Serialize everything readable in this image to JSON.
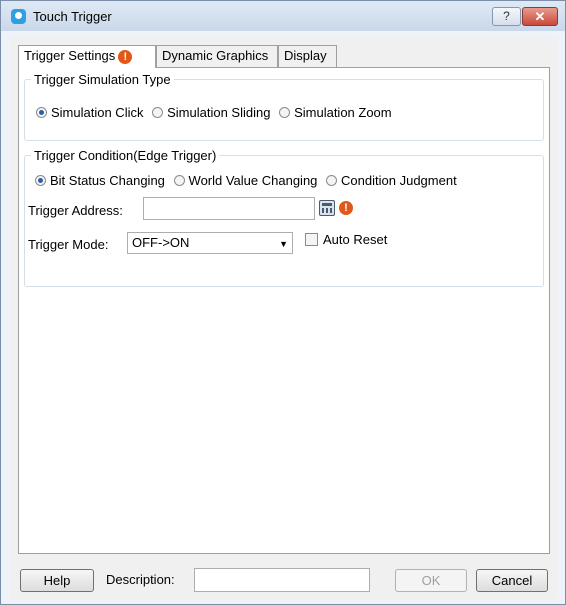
{
  "window": {
    "title": "Touch Trigger",
    "help_glyph": "?",
    "close_glyph": "✕"
  },
  "tabs": [
    {
      "label": "Trigger Settings",
      "warning": "!"
    },
    {
      "label": "Dynamic Graphics"
    },
    {
      "label": "Display"
    }
  ],
  "simulation_type": {
    "title": "Trigger Simulation Type",
    "options": [
      "Simulation Click",
      "Simulation Sliding",
      "Simulation Zoom"
    ],
    "selected": "Simulation Click"
  },
  "condition": {
    "title": "Trigger Condition(Edge Trigger)",
    "options": [
      "Bit Status Changing",
      "World Value Changing",
      "Condition Judgment"
    ],
    "selected": "Bit Status Changing",
    "address_label": "Trigger Address:",
    "address_value": "",
    "address_warning": "!",
    "mode_label": "Trigger Mode:",
    "mode_value": "OFF->ON",
    "auto_reset_label": "Auto Reset",
    "auto_reset_checked": false
  },
  "footer": {
    "help_label": "Help",
    "description_label": "Description:",
    "description_value": "",
    "ok_label": "OK",
    "cancel_label": "Cancel"
  },
  "colors": {
    "accent": "#2f9fe0",
    "warning": "#e25818"
  },
  "icons": [
    "app-icon",
    "help-icon",
    "close-icon",
    "warning-icon",
    "calculator-icon",
    "chevron-down-icon"
  ]
}
